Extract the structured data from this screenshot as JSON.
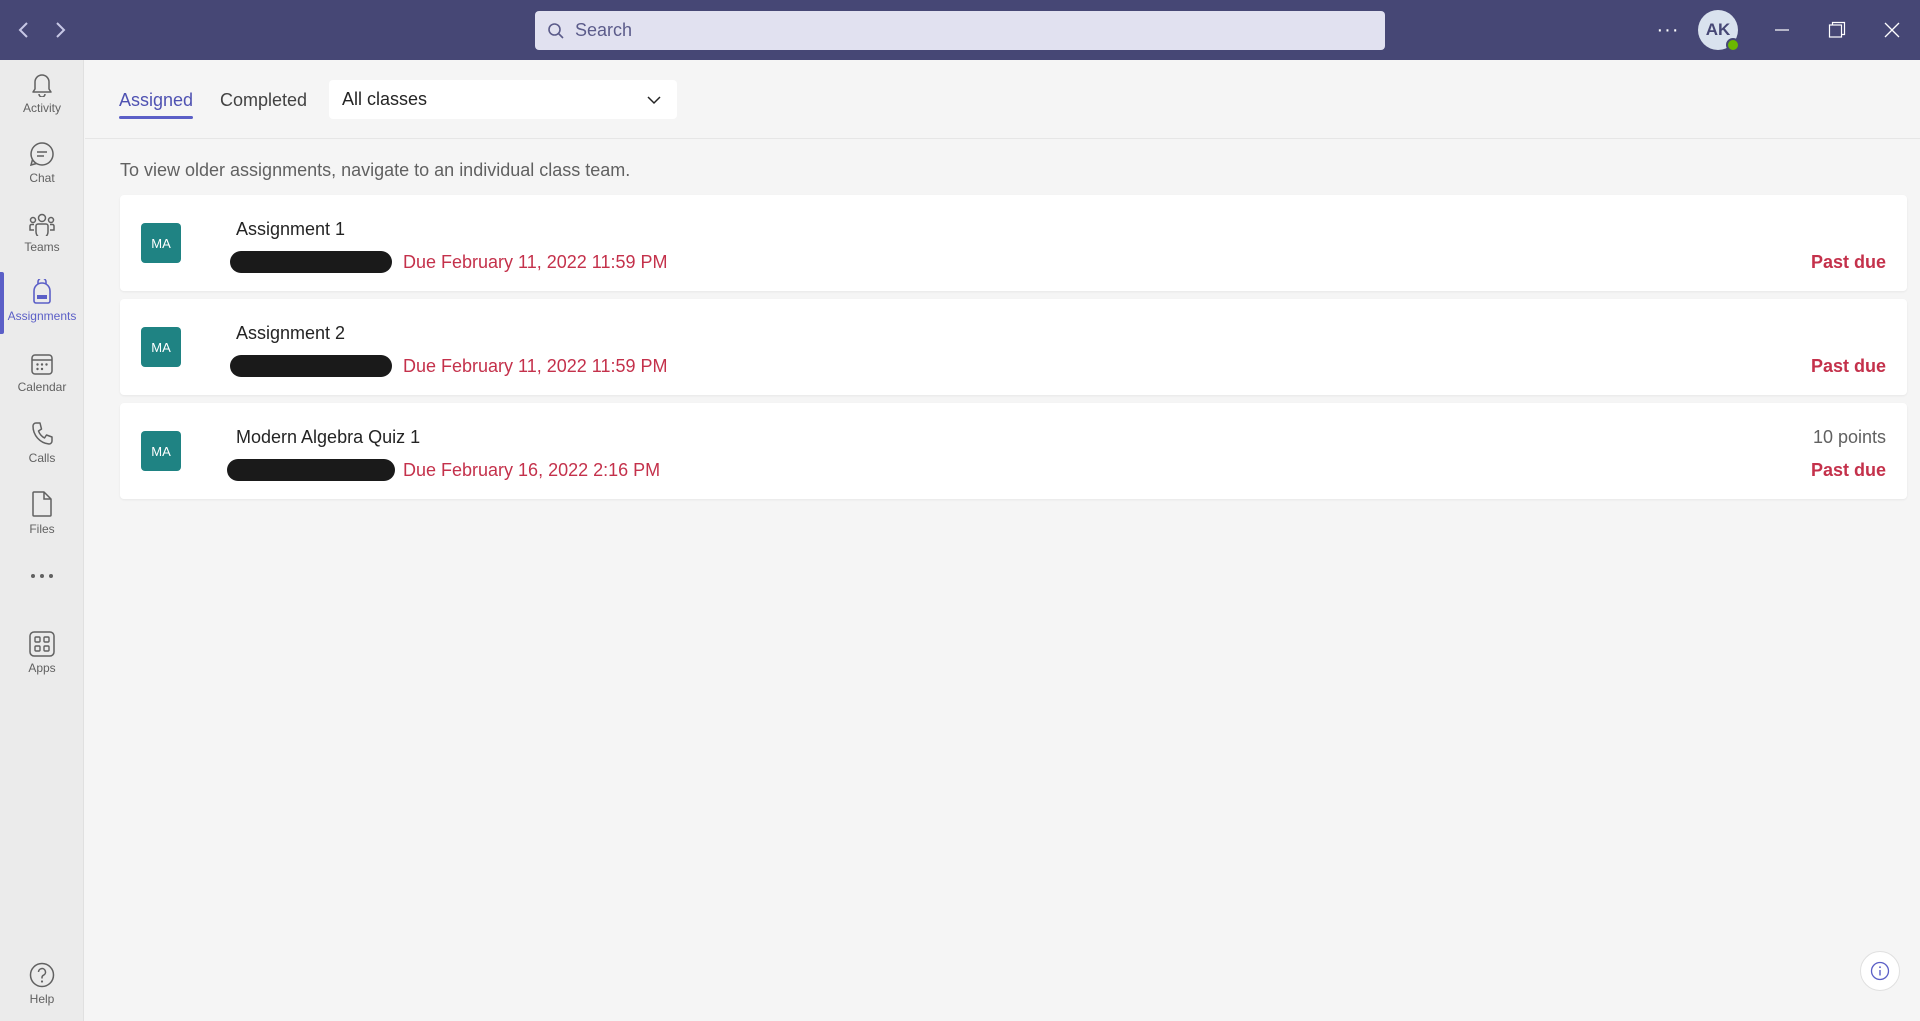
{
  "titlebar": {
    "search_placeholder": "Search",
    "avatar_initials": "AK",
    "more_label": "···"
  },
  "rail": {
    "items": [
      {
        "label": "Activity",
        "icon": "bell-icon"
      },
      {
        "label": "Chat",
        "icon": "chat-icon"
      },
      {
        "label": "Teams",
        "icon": "teams-icon"
      },
      {
        "label": "Assignments",
        "icon": "backpack-icon",
        "active": true
      },
      {
        "label": "Calendar",
        "icon": "calendar-icon"
      },
      {
        "label": "Calls",
        "icon": "phone-icon"
      },
      {
        "label": "Files",
        "icon": "file-icon"
      },
      {
        "label": "",
        "icon": "more-icon"
      },
      {
        "label": "Apps",
        "icon": "apps-icon"
      }
    ],
    "help_label": "Help"
  },
  "main": {
    "tabs": [
      {
        "label": "Assigned",
        "active": true
      },
      {
        "label": "Completed",
        "active": false
      }
    ],
    "class_filter": "All classes",
    "notice": "To view older assignments, navigate to an individual class team.",
    "assignments": [
      {
        "badge": "MA",
        "title": "Assignment 1",
        "due": "Due February 11, 2022 11:59 PM",
        "points": "",
        "status": "Past due"
      },
      {
        "badge": "MA",
        "title": "Assignment 2",
        "due": "Due February 11, 2022 11:59 PM",
        "points": "",
        "status": "Past due"
      },
      {
        "badge": "MA",
        "title": "Modern Algebra Quiz 1",
        "due": "Due February 16, 2022 2:16 PM",
        "points": "10 points",
        "status": "Past due"
      }
    ]
  },
  "colors": {
    "titlebar": "#464775",
    "accent": "#5b5fc7",
    "due_red": "#c4314b",
    "badge_teal": "#1f8383"
  }
}
